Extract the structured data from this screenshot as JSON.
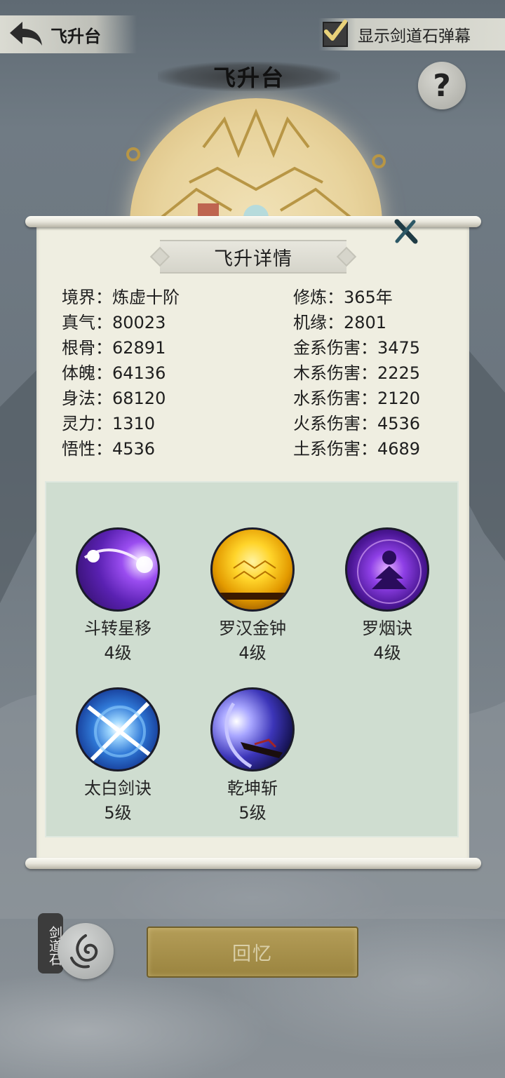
{
  "header": {
    "back_label": "飞升台",
    "toggle_label": "显示剑道石弹幕",
    "toggle_checked": true,
    "page_title": "飞升台",
    "help_symbol": "?"
  },
  "panel": {
    "title": "飞升详情",
    "stats_left": [
      {
        "key": "境界：",
        "value": "炼虚十阶"
      },
      {
        "key": "真气：",
        "value": "80023"
      },
      {
        "key": "根骨：",
        "value": "62891"
      },
      {
        "key": "体魄：",
        "value": "64136"
      },
      {
        "key": "身法：",
        "value": "68120"
      },
      {
        "key": "灵力：",
        "value": "1310"
      },
      {
        "key": "悟性：",
        "value": "4536"
      }
    ],
    "stats_right": [
      {
        "key": "修炼：",
        "value": "365年"
      },
      {
        "key": "机缘：",
        "value": "2801"
      },
      {
        "key": "金系伤害：",
        "value": "3475"
      },
      {
        "key": "木系伤害：",
        "value": "2225"
      },
      {
        "key": "水系伤害：",
        "value": "2120"
      },
      {
        "key": "火系伤害：",
        "value": "4536"
      },
      {
        "key": "土系伤害：",
        "value": "4689"
      }
    ],
    "skills": [
      {
        "name": "斗转星移",
        "level": "4级",
        "icon": "star-shift-skill-icon"
      },
      {
        "name": "罗汉金钟",
        "level": "4级",
        "icon": "golden-bell-skill-icon"
      },
      {
        "name": "罗烟诀",
        "level": "4级",
        "icon": "meditation-skill-icon"
      },
      {
        "name": "太白剑诀",
        "level": "5级",
        "icon": "sword-slash-skill-icon"
      },
      {
        "name": "乾坤斩",
        "level": "5级",
        "icon": "blade-skill-icon"
      }
    ]
  },
  "bottom": {
    "stone_tag": "剑道石",
    "recall_label": "回忆"
  },
  "colors": {
    "panel_bg": "#efeee1",
    "skills_bg": "#cfddd0",
    "recall_button": "#a8914c"
  }
}
